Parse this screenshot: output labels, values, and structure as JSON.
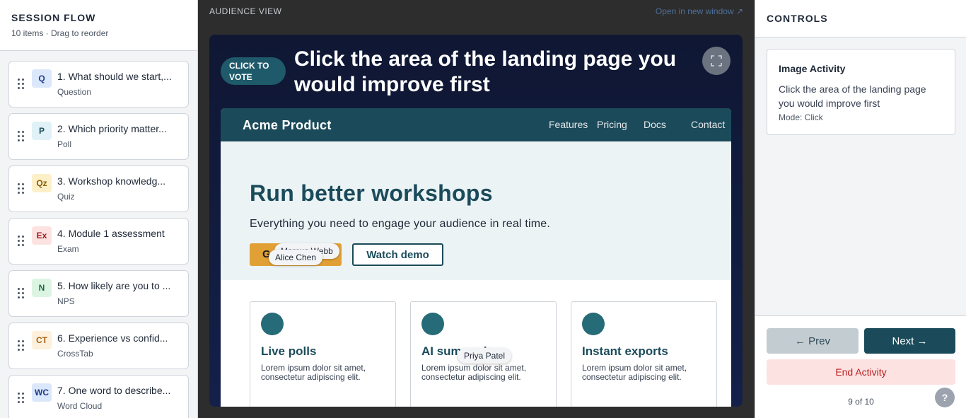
{
  "sidebar": {
    "title": "SESSION FLOW",
    "subtitle": "10 items · Drag to reorder",
    "items": [
      {
        "badge": "Q",
        "badge_bg": "#dbe7fb",
        "badge_fg": "#1e3a8a",
        "title": "1. What should we start,...",
        "type": "Question"
      },
      {
        "badge": "P",
        "badge_bg": "#e0f2f7",
        "badge_fg": "#1b4b5a",
        "title": "2. Which priority matter...",
        "type": "Poll"
      },
      {
        "badge": "Qz",
        "badge_bg": "#fdf0c8",
        "badge_fg": "#8a5a00",
        "title": "3. Workshop knowledg...",
        "type": "Quiz"
      },
      {
        "badge": "Ex",
        "badge_bg": "#fde2e2",
        "badge_fg": "#9b1c1c",
        "title": "4. Module 1 assessment",
        "type": "Exam"
      },
      {
        "badge": "N",
        "badge_bg": "#dcf5e3",
        "badge_fg": "#1f6b3a",
        "title": "5. How likely are you to ...",
        "type": "NPS"
      },
      {
        "badge": "CT",
        "badge_bg": "#fdf0dc",
        "badge_fg": "#a0611a",
        "title": "6. Experience vs confid...",
        "type": "CrossTab"
      },
      {
        "badge": "WC",
        "badge_bg": "#dbe7fb",
        "badge_fg": "#1e3a8a",
        "title": "7. One word to describe...",
        "type": "Word Cloud"
      }
    ]
  },
  "center": {
    "label": "AUDIENCE VIEW",
    "open_link": "Open in new window ↗",
    "vote_pill": "CLICK TO VOTE",
    "title": "Click the area of the landing page you would improve first",
    "landing": {
      "brand": "Acme Product",
      "nav": [
        "Features",
        "Pricing",
        "Docs",
        "Contact"
      ],
      "headline": "Run better workshops",
      "subline": "Everything you need to engage your audience in real time.",
      "cta_primary": "Get started",
      "cta_secondary": "Watch demo",
      "cards": [
        {
          "title": "Live polls",
          "text": "Lorem ipsum dolor sit amet, consectetur adipiscing elit."
        },
        {
          "title": "AI summaries",
          "text": "Lorem ipsum dolor sit amet, consectetur adipiscing elit."
        },
        {
          "title": "Instant exports",
          "text": "Lorem ipsum dolor sit amet, consectetur adipiscing elit."
        }
      ],
      "participants": [
        "Marcus Webb",
        "Alice Chen",
        "Priya Patel"
      ]
    }
  },
  "right": {
    "title": "CONTROLS",
    "activity": {
      "title": "Image Activity",
      "prompt": "Click the area of the landing page you would improve first",
      "mode": "Mode: Click"
    },
    "prev": "← Prev",
    "next": "Next →",
    "end": "End Activity",
    "counter": "9 of 10",
    "help": "?"
  }
}
